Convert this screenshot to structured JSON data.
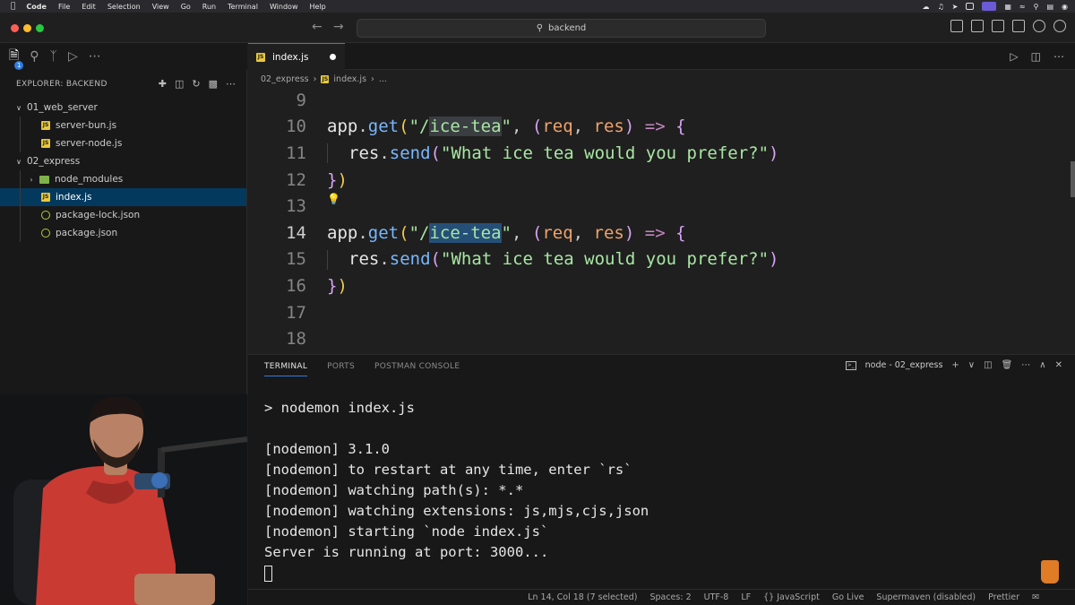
{
  "menubar": {
    "items": [
      "Code",
      "File",
      "Edit",
      "Selection",
      "View",
      "Go",
      "Run",
      "Terminal",
      "Window",
      "Help"
    ]
  },
  "titlebar": {
    "search_text": "backend"
  },
  "explorer": {
    "header": "EXPLORER: BACKEND",
    "tree": [
      {
        "label": "01_web_server",
        "type": "folder-open",
        "depth": 0
      },
      {
        "label": "server-bun.js",
        "type": "js",
        "depth": 1
      },
      {
        "label": "server-node.js",
        "type": "js",
        "depth": 1
      },
      {
        "label": "02_express",
        "type": "folder-open",
        "depth": 0
      },
      {
        "label": "node_modules",
        "type": "folder",
        "depth": 1
      },
      {
        "label": "index.js",
        "type": "js",
        "depth": 1,
        "selected": true
      },
      {
        "label": "package-lock.json",
        "type": "json",
        "depth": 1
      },
      {
        "label": "package.json",
        "type": "json",
        "depth": 1
      }
    ],
    "badge": "1"
  },
  "editor": {
    "tab_label": "index.js",
    "breadcrumb": [
      "02_express",
      "index.js",
      "..."
    ],
    "lines": [
      {
        "n": "9"
      },
      {
        "n": "10",
        "text": "app.get(\"/ice-tea\", (req, res) => {"
      },
      {
        "n": "11",
        "text": "res.send(\"What ice tea would you prefer?\")"
      },
      {
        "n": "12",
        "text": "})"
      },
      {
        "n": "13"
      },
      {
        "n": "14",
        "text": "app.get(\"/ice-tea\", (req, res) => {"
      },
      {
        "n": "15",
        "text": "res.send(\"What ice tea would you prefer?\")"
      },
      {
        "n": "16",
        "text": "})"
      },
      {
        "n": "17"
      },
      {
        "n": "18"
      }
    ]
  },
  "panel": {
    "tabs": [
      "TERMINAL",
      "PORTS",
      "POSTMAN CONSOLE"
    ],
    "terminal_name": "node - 02_express",
    "term_icon": ">_",
    "terminal_lines": [
      "> nodemon index.js",
      "",
      "[nodemon] 3.1.0",
      "[nodemon] to restart at any time, enter `rs`",
      "[nodemon] watching path(s): *.*",
      "[nodemon] watching extensions: js,mjs,cjs,json",
      "[nodemon] starting `node index.js`",
      "Server is running at port: 3000..."
    ]
  },
  "statusbar": {
    "items": [
      "Ln 14, Col 18 (7 selected)",
      "Spaces: 2",
      "UTF-8",
      "LF",
      "{} JavaScript",
      "Go Live",
      "Supermaven (disabled)",
      "Prettier"
    ]
  },
  "colors": {
    "accent": "#2f7de1",
    "selection": "#04395e",
    "string": "#a8e6a3",
    "function": "#79b8ff",
    "param": "#f0a36b"
  }
}
